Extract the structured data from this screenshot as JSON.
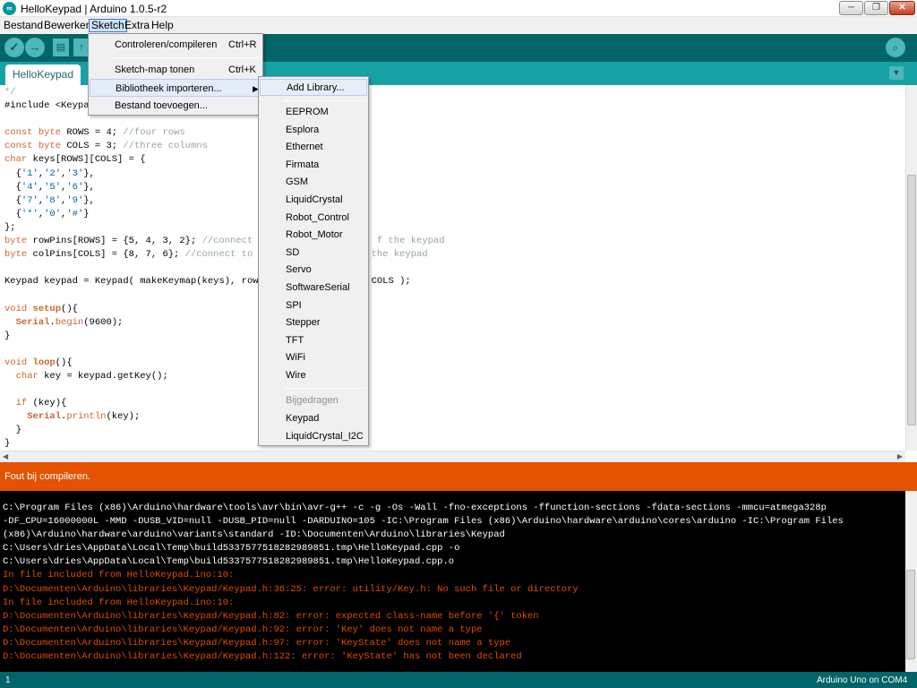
{
  "window": {
    "title": "HelloKeypad | Arduino 1.0.5-r2",
    "icon_text": "∞",
    "minimize": "─",
    "maximize": "❐",
    "close": "✕"
  },
  "menubar": {
    "items": [
      "Bestand",
      "Bewerken",
      "Sketch",
      "Extra",
      "Help"
    ]
  },
  "toolbar": {
    "verify": "✓",
    "upload": "→",
    "new": "▤",
    "open": "↑",
    "serial": "⌕",
    "icons": [
      "check-icon",
      "arrow-right-icon",
      "new-file-icon",
      "open-icon",
      "serial-monitor-icon"
    ]
  },
  "tab": {
    "label": "HelloKeypad",
    "menu_arrow": "▼"
  },
  "editor": {
    "lines": [
      [
        {
          "t": "*/",
          "c": "cm"
        }
      ],
      [
        {
          "t": "#include <Keypa",
          "c": ""
        }
      ],
      [
        {
          "t": "",
          "c": ""
        }
      ],
      [
        {
          "t": "const",
          "c": "kw"
        },
        {
          "t": " ",
          "c": ""
        },
        {
          "t": "byte",
          "c": "kw"
        },
        {
          "t": " ROWS = 4; ",
          "c": ""
        },
        {
          "t": "//four rows",
          "c": "cm"
        }
      ],
      [
        {
          "t": "const",
          "c": "kw"
        },
        {
          "t": " ",
          "c": ""
        },
        {
          "t": "byte",
          "c": "kw"
        },
        {
          "t": " COLS = 3; ",
          "c": ""
        },
        {
          "t": "//three columns",
          "c": "cm"
        }
      ],
      [
        {
          "t": "char",
          "c": "kw"
        },
        {
          "t": " keys[ROWS][COLS] = {",
          "c": ""
        }
      ],
      [
        {
          "t": "  {",
          "c": ""
        },
        {
          "t": "'1'",
          "c": "st"
        },
        {
          "t": ",",
          "c": ""
        },
        {
          "t": "'2'",
          "c": "st"
        },
        {
          "t": ",",
          "c": ""
        },
        {
          "t": "'3'",
          "c": "st"
        },
        {
          "t": "},",
          "c": ""
        }
      ],
      [
        {
          "t": "  {",
          "c": ""
        },
        {
          "t": "'4'",
          "c": "st"
        },
        {
          "t": ",",
          "c": ""
        },
        {
          "t": "'5'",
          "c": "st"
        },
        {
          "t": ",",
          "c": ""
        },
        {
          "t": "'6'",
          "c": "st"
        },
        {
          "t": "},",
          "c": ""
        }
      ],
      [
        {
          "t": "  {",
          "c": ""
        },
        {
          "t": "'7'",
          "c": "st"
        },
        {
          "t": ",",
          "c": ""
        },
        {
          "t": "'8'",
          "c": "st"
        },
        {
          "t": ",",
          "c": ""
        },
        {
          "t": "'9'",
          "c": "st"
        },
        {
          "t": "},",
          "c": ""
        }
      ],
      [
        {
          "t": "  {",
          "c": ""
        },
        {
          "t": "'*'",
          "c": "st"
        },
        {
          "t": ",",
          "c": ""
        },
        {
          "t": "'0'",
          "c": "st"
        },
        {
          "t": ",",
          "c": ""
        },
        {
          "t": "'#'",
          "c": "st"
        },
        {
          "t": "}",
          "c": ""
        }
      ],
      [
        {
          "t": "};",
          "c": ""
        }
      ],
      [
        {
          "t": "byte",
          "c": "kw"
        },
        {
          "t": " rowPins[ROWS] = {5, 4, 3, 2}; ",
          "c": ""
        },
        {
          "t": "//connect t                    f the keypad",
          "c": "cm"
        }
      ],
      [
        {
          "t": "byte",
          "c": "kw"
        },
        {
          "t": " colPins[COLS] = {8, 7, 6}; ",
          "c": ""
        },
        {
          "t": "//connect to                   f the keypad",
          "c": "cm"
        }
      ],
      [
        {
          "t": "",
          "c": ""
        }
      ],
      [
        {
          "t": "Keypad keypad = Keypad( makeKeymap(keys), rowF                   COLS );",
          "c": ""
        }
      ],
      [
        {
          "t": "",
          "c": ""
        }
      ],
      [
        {
          "t": "void",
          "c": "kw"
        },
        {
          "t": " ",
          "c": ""
        },
        {
          "t": "setup",
          "c": "fn"
        },
        {
          "t": "(){",
          "c": ""
        }
      ],
      [
        {
          "t": "  ",
          "c": ""
        },
        {
          "t": "Serial",
          "c": "fn"
        },
        {
          "t": ".",
          "c": ""
        },
        {
          "t": "begin",
          "c": "kw"
        },
        {
          "t": "(9600);",
          "c": ""
        }
      ],
      [
        {
          "t": "}",
          "c": ""
        }
      ],
      [
        {
          "t": "",
          "c": ""
        }
      ],
      [
        {
          "t": "void",
          "c": "kw"
        },
        {
          "t": " ",
          "c": ""
        },
        {
          "t": "loop",
          "c": "fn"
        },
        {
          "t": "(){",
          "c": ""
        }
      ],
      [
        {
          "t": "  ",
          "c": ""
        },
        {
          "t": "char",
          "c": "kw"
        },
        {
          "t": " key = keypad.getKey();",
          "c": ""
        }
      ],
      [
        {
          "t": "",
          "c": ""
        }
      ],
      [
        {
          "t": "  ",
          "c": ""
        },
        {
          "t": "if",
          "c": "kw"
        },
        {
          "t": " (key){",
          "c": ""
        }
      ],
      [
        {
          "t": "    ",
          "c": ""
        },
        {
          "t": "Serial",
          "c": "fn"
        },
        {
          "t": ".",
          "c": ""
        },
        {
          "t": "println",
          "c": "kw"
        },
        {
          "t": "(key);",
          "c": ""
        }
      ],
      [
        {
          "t": "  }",
          "c": ""
        }
      ],
      [
        {
          "t": "}",
          "c": ""
        }
      ]
    ],
    "hscroll_left": "◀",
    "hscroll_right": "▶"
  },
  "status": {
    "message": "Fout bij compileren.",
    "color": "#e35200"
  },
  "console": {
    "lines": [
      {
        "text": "C:\\Program Files (x86)\\Arduino\\hardware\\tools\\avr\\bin\\avr-g++ -c -g -Os -Wall -fno-exceptions -ffunction-sections -fdata-sections -mmcu=atmega328p",
        "color": "white"
      },
      {
        "text": "-DF_CPU=16000000L -MMD -DUSB_VID=null -DUSB_PID=null -DARDUINO=105 -IC:\\Program Files (x86)\\Arduino\\hardware\\arduino\\cores\\arduino -IC:\\Program Files",
        "color": "white"
      },
      {
        "text": "(x86)\\Arduino\\hardware\\arduino\\variants\\standard -ID:\\Documenten\\Arduino\\libraries\\Keypad",
        "color": "white"
      },
      {
        "text": "C:\\Users\\dries\\AppData\\Local\\Temp\\build5337577518282989851.tmp\\HelloKeypad.cpp -o",
        "color": "white"
      },
      {
        "text": "C:\\Users\\dries\\AppData\\Local\\Temp\\build5337577518282989851.tmp\\HelloKeypad.cpp.o",
        "color": "white"
      },
      {
        "text": "In file included from HelloKeypad.ino:10:",
        "color": "red"
      },
      {
        "text": "D:\\Documenten\\Arduino\\libraries\\Keypad/Keypad.h:36:25: error: utility/Key.h: No such file or directory",
        "color": "red"
      },
      {
        "text": "In file included from HelloKeypad.ino:10:",
        "color": "red"
      },
      {
        "text": "D:\\Documenten\\Arduino\\libraries\\Keypad/Keypad.h:82: error: expected class-name before '{' token",
        "color": "red"
      },
      {
        "text": "D:\\Documenten\\Arduino\\libraries\\Keypad/Keypad.h:92: error: 'Key' does not name a type",
        "color": "red"
      },
      {
        "text": "D:\\Documenten\\Arduino\\libraries\\Keypad/Keypad.h:97: error: 'KeyState' does not name a type",
        "color": "red"
      },
      {
        "text": "D:\\Documenten\\Arduino\\libraries\\Keypad/Keypad.h:122: error: 'KeyState' has not been declared",
        "color": "red"
      }
    ]
  },
  "footer": {
    "line_number": "1",
    "board": "Arduino Uno on COM4"
  },
  "sketch_menu": {
    "items": [
      {
        "label": "Controleren/compileren",
        "shortcut": "Ctrl+R",
        "arrow": ""
      },
      {
        "label": "Sketch-map tonen",
        "shortcut": "Ctrl+K",
        "arrow": ""
      },
      {
        "label": "Bibliotheek importeren...",
        "shortcut": "",
        "arrow": "▶"
      },
      {
        "label": "Bestand toevoegen...",
        "shortcut": "",
        "arrow": ""
      }
    ]
  },
  "library_menu": {
    "add": "Add Library...",
    "builtin": [
      "EEPROM",
      "Esplora",
      "Ethernet",
      "Firmata",
      "GSM",
      "LiquidCrystal",
      "Robot_Control",
      "Robot_Motor",
      "SD",
      "Servo",
      "SoftwareSerial",
      "SPI",
      "Stepper",
      "TFT",
      "WiFi",
      "Wire"
    ],
    "contributed_header": "Bijgedragen",
    "contributed": [
      "Keypad",
      "LiquidCrystal_I2C"
    ]
  }
}
